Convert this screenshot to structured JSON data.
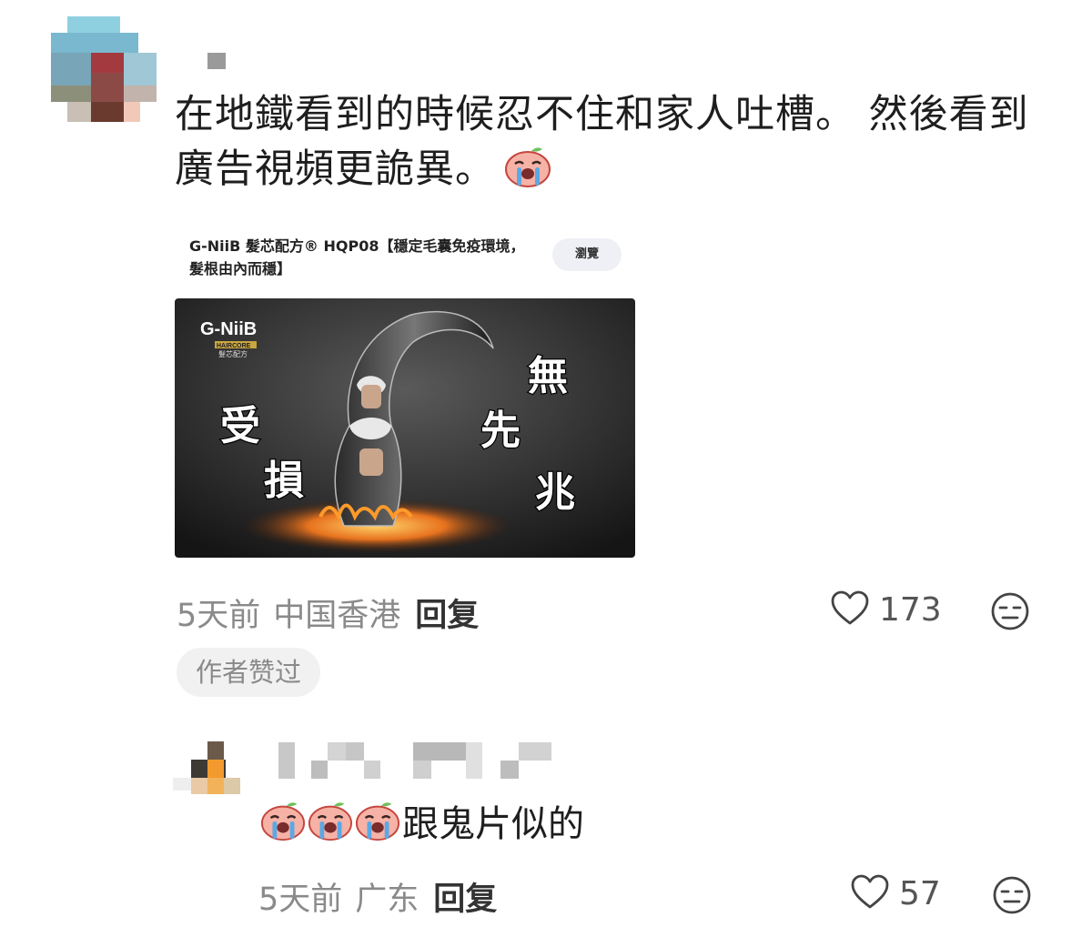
{
  "comment": {
    "text_line1": "在地鐵看到的時候忍不住和家人吐槽。 然後看到",
    "text_line2": "廣告視頻更詭異。",
    "emoji": "crying-peach-emoji",
    "ad": {
      "title": "G-NiiB 髮芯配方® HQP08【穩定毛囊免疫環境，髮根由內而穩】",
      "browse_label": "瀏覽",
      "image": {
        "brand": "G-NiiB",
        "brand_sub": "髮芯配方",
        "brand_tag": "HAIRCORE",
        "caption_left": [
          "受",
          "損"
        ],
        "caption_right": [
          "無",
          "先",
          "兆"
        ]
      }
    },
    "time": "5天前",
    "location": "中国香港",
    "reply_label": "回复",
    "likes": "173",
    "author_liked": "作者赞过"
  },
  "reply": {
    "text": "跟鬼片似的",
    "emoji_count": 3,
    "time": "5天前",
    "location": "广东",
    "reply_label": "回复",
    "likes": "57"
  },
  "icons": {
    "like": "heart-outline-icon",
    "reaction": "expressionless-face-icon"
  }
}
